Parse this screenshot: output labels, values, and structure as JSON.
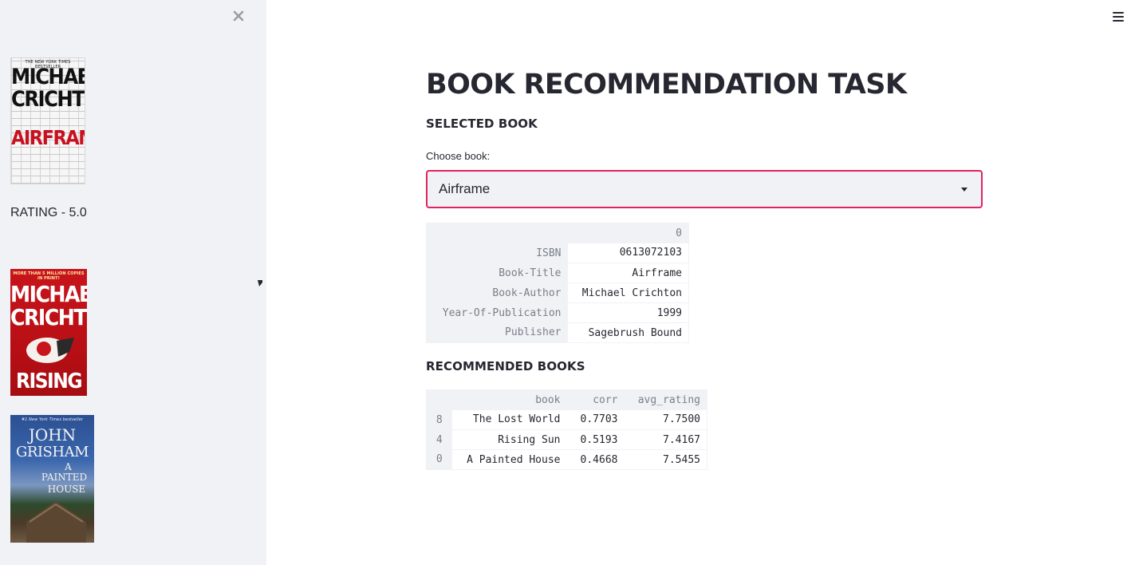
{
  "sidebar": {
    "close_icon": "close-icon",
    "covers": [
      {
        "id": "airframe",
        "tag": "THE NEW YORK TIMES BESTSELLER",
        "author_line1": "MICHAEL",
        "author_line2": "CRICHTON",
        "title": "AIRFRAME"
      },
      {
        "id": "rising-sun",
        "tag": "MORE THAN 5 MILLION COPIES IN PRINT!",
        "author_line1": "MICHAEL",
        "author_line2": "CRICHTON",
        "title": "RISING SUN"
      },
      {
        "id": "painted-house",
        "tag": "#1 New York Times bestseller",
        "author_line1": "JOHN",
        "author_line2": "GRISHAM",
        "title_line1": "A",
        "title_line2": "PAINTED",
        "title_line3": "HOUSE"
      }
    ],
    "rating_text": "RATING - 5.0"
  },
  "header": {
    "menu_icon": "hamburger-menu-icon"
  },
  "main": {
    "title": "BOOK RECOMMENDATION TASK",
    "selected_heading": "SELECTED BOOK",
    "select_label": "Choose book:",
    "select_value": "Airframe",
    "selected_table": {
      "column": "0",
      "rows": [
        {
          "key": "ISBN",
          "value": "0613072103"
        },
        {
          "key": "Book-Title",
          "value": "Airframe"
        },
        {
          "key": "Book-Author",
          "value": "Michael Crichton"
        },
        {
          "key": "Year-Of-Publication",
          "value": "1999"
        },
        {
          "key": "Publisher",
          "value": "Sagebrush Bound"
        }
      ]
    },
    "recommended_heading": "RECOMMENDED BOOKS",
    "recommended_table": {
      "columns": [
        "book",
        "corr",
        "avg_rating"
      ],
      "rows": [
        {
          "index": "8",
          "book": "The Lost World",
          "corr": "0.7703",
          "avg_rating": "7.7500"
        },
        {
          "index": "4",
          "book": "Rising Sun",
          "corr": "0.5193",
          "avg_rating": "7.4167"
        },
        {
          "index": "0",
          "book": "A Painted House",
          "corr": "0.4668",
          "avg_rating": "7.5455"
        }
      ]
    }
  },
  "colors": {
    "accent": "#e0245e",
    "sidebar_bg": "#f0f2f6",
    "text": "#262730",
    "muted": "#7b7f88"
  }
}
